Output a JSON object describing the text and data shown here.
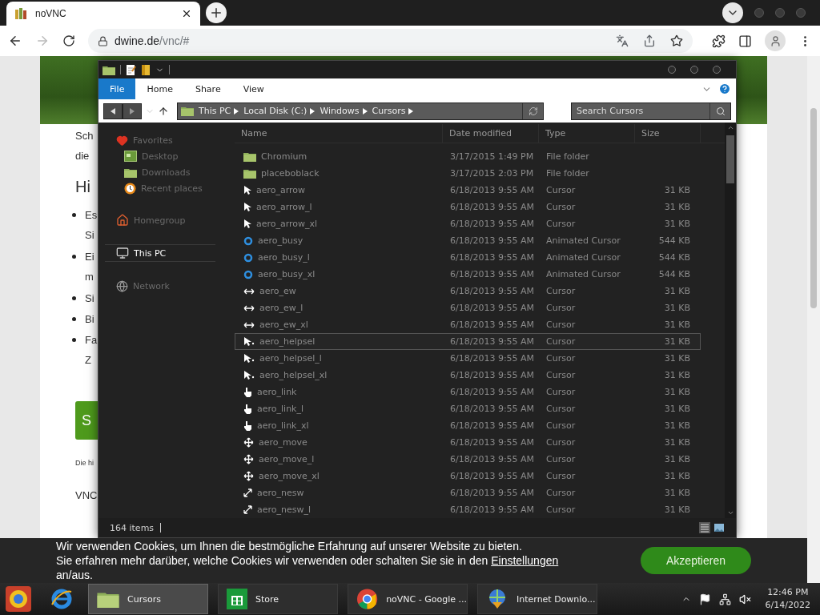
{
  "browser": {
    "tab": {
      "title": "noVNC",
      "selected": true
    },
    "url": {
      "host": "dwine.de",
      "path": "/vnc/#"
    }
  },
  "webpage": {
    "intro": [
      "Sch",
      "die"
    ],
    "heading": "Hi",
    "bullets": [
      {
        "text": "Es",
        "continuation": "Si"
      },
      {
        "text": "Ei",
        "continuation": "m"
      },
      {
        "text": "Si"
      },
      {
        "text": "Bi"
      },
      {
        "text": "Fa",
        "continuation": "Z"
      }
    ],
    "button": "S",
    "note": "Die hi",
    "footer": "VNC"
  },
  "explorer": {
    "ribbon_tabs": [
      {
        "label": "File",
        "selected": true
      },
      {
        "label": "Home",
        "selected": false
      },
      {
        "label": "Share",
        "selected": false
      },
      {
        "label": "View",
        "selected": false
      }
    ],
    "breadcrumb": [
      "This PC",
      "Local Disk (C:)",
      "Windows",
      "Cursors"
    ],
    "search": {
      "placeholder": "Search Cursors"
    },
    "nav": [
      {
        "kind": "favorites",
        "label": "Favorites",
        "selected": false,
        "children": [
          {
            "kind": "desktop",
            "label": "Desktop",
            "selected": false
          },
          {
            "kind": "downloads",
            "label": "Downloads",
            "selected": false
          },
          {
            "kind": "recent",
            "label": "Recent places",
            "selected": false
          }
        ]
      },
      {
        "kind": "homegroup",
        "label": "Homegroup",
        "selected": false
      },
      {
        "kind": "pc",
        "label": "This PC",
        "selected": true
      },
      {
        "kind": "network",
        "label": "Network",
        "selected": false
      }
    ],
    "columns": [
      "Name",
      "Date modified",
      "Type",
      "Size"
    ],
    "rows": [
      {
        "kind": "folder",
        "name": "Chromium",
        "date": "3/17/2015 1:49 PM",
        "type": "File folder",
        "selected": false
      },
      {
        "kind": "folder",
        "name": "placeboblack",
        "date": "3/17/2015 2:03 PM",
        "type": "File folder",
        "selected": false
      },
      {
        "kind": "arrow",
        "name": "aero_arrow",
        "date": "6/18/2013 9:55 AM",
        "type": "Cursor",
        "size": "31 KB",
        "selected": false
      },
      {
        "kind": "arrow",
        "name": "aero_arrow_l",
        "date": "6/18/2013 9:55 AM",
        "type": "Cursor",
        "size": "31 KB",
        "selected": false
      },
      {
        "kind": "arrow",
        "name": "aero_arrow_xl",
        "date": "6/18/2013 9:55 AM",
        "type": "Cursor",
        "size": "31 KB",
        "selected": false
      },
      {
        "kind": "busy",
        "name": "aero_busy",
        "date": "6/18/2013 9:55 AM",
        "type": "Animated Cursor",
        "size": "544 KB",
        "selected": false
      },
      {
        "kind": "busy",
        "name": "aero_busy_l",
        "date": "6/18/2013 9:55 AM",
        "type": "Animated Cursor",
        "size": "544 KB",
        "selected": false
      },
      {
        "kind": "busy",
        "name": "aero_busy_xl",
        "date": "6/18/2013 9:55 AM",
        "type": "Animated Cursor",
        "size": "544 KB",
        "selected": false
      },
      {
        "kind": "ew",
        "name": "aero_ew",
        "date": "6/18/2013 9:55 AM",
        "type": "Cursor",
        "size": "31 KB",
        "selected": false
      },
      {
        "kind": "ew",
        "name": "aero_ew_l",
        "date": "6/18/2013 9:55 AM",
        "type": "Cursor",
        "size": "31 KB",
        "selected": false
      },
      {
        "kind": "ew",
        "name": "aero_ew_xl",
        "date": "6/18/2013 9:55 AM",
        "type": "Cursor",
        "size": "31 KB",
        "selected": false
      },
      {
        "kind": "help",
        "name": "aero_helpsel",
        "date": "6/18/2013 9:55 AM",
        "type": "Cursor",
        "size": "31 KB",
        "selected": true
      },
      {
        "kind": "help",
        "name": "aero_helpsel_l",
        "date": "6/18/2013 9:55 AM",
        "type": "Cursor",
        "size": "31 KB",
        "selected": false
      },
      {
        "kind": "help",
        "name": "aero_helpsel_xl",
        "date": "6/18/2013 9:55 AM",
        "type": "Cursor",
        "size": "31 KB",
        "selected": false
      },
      {
        "kind": "link",
        "name": "aero_link",
        "date": "6/18/2013 9:55 AM",
        "type": "Cursor",
        "size": "31 KB",
        "selected": false
      },
      {
        "kind": "link",
        "name": "aero_link_l",
        "date": "6/18/2013 9:55 AM",
        "type": "Cursor",
        "size": "31 KB",
        "selected": false
      },
      {
        "kind": "link",
        "name": "aero_link_xl",
        "date": "6/18/2013 9:55 AM",
        "type": "Cursor",
        "size": "31 KB",
        "selected": false
      },
      {
        "kind": "move",
        "name": "aero_move",
        "date": "6/18/2013 9:55 AM",
        "type": "Cursor",
        "size": "31 KB",
        "selected": false
      },
      {
        "kind": "move",
        "name": "aero_move_l",
        "date": "6/18/2013 9:55 AM",
        "type": "Cursor",
        "size": "31 KB",
        "selected": false
      },
      {
        "kind": "move",
        "name": "aero_move_xl",
        "date": "6/18/2013 9:55 AM",
        "type": "Cursor",
        "size": "31 KB",
        "selected": false
      },
      {
        "kind": "nesw",
        "name": "aero_nesw",
        "date": "6/18/2013 9:55 AM",
        "type": "Cursor",
        "size": "31 KB",
        "selected": false
      },
      {
        "kind": "nesw",
        "name": "aero_nesw_l",
        "date": "6/18/2013 9:55 AM",
        "type": "Cursor",
        "size": "31 KB",
        "selected": false
      }
    ],
    "status": "164 items"
  },
  "cookie_banner": {
    "line1": "Wir verwenden Cookies, um Ihnen die bestmögliche Erfahrung auf unserer Website zu bieten.",
    "text_before": "Sie erfahren mehr darüber, welche Cookies wir verwenden oder schalten Sie sie in den",
    "link": "Einstellungen",
    "text_after": "an/aus.",
    "button": "Akzeptieren"
  },
  "taskbar": {
    "tasks": [
      {
        "kind": "explorer",
        "label": "Cursors",
        "selected": true
      },
      {
        "kind": "store",
        "label": "Store",
        "selected": false
      },
      {
        "kind": "chrome",
        "label": "noVNC - Google ...",
        "selected": false
      },
      {
        "kind": "idm",
        "label": "Internet Downlo...",
        "selected": false
      }
    ],
    "time": "12:46 PM",
    "date": "6/14/2022"
  }
}
